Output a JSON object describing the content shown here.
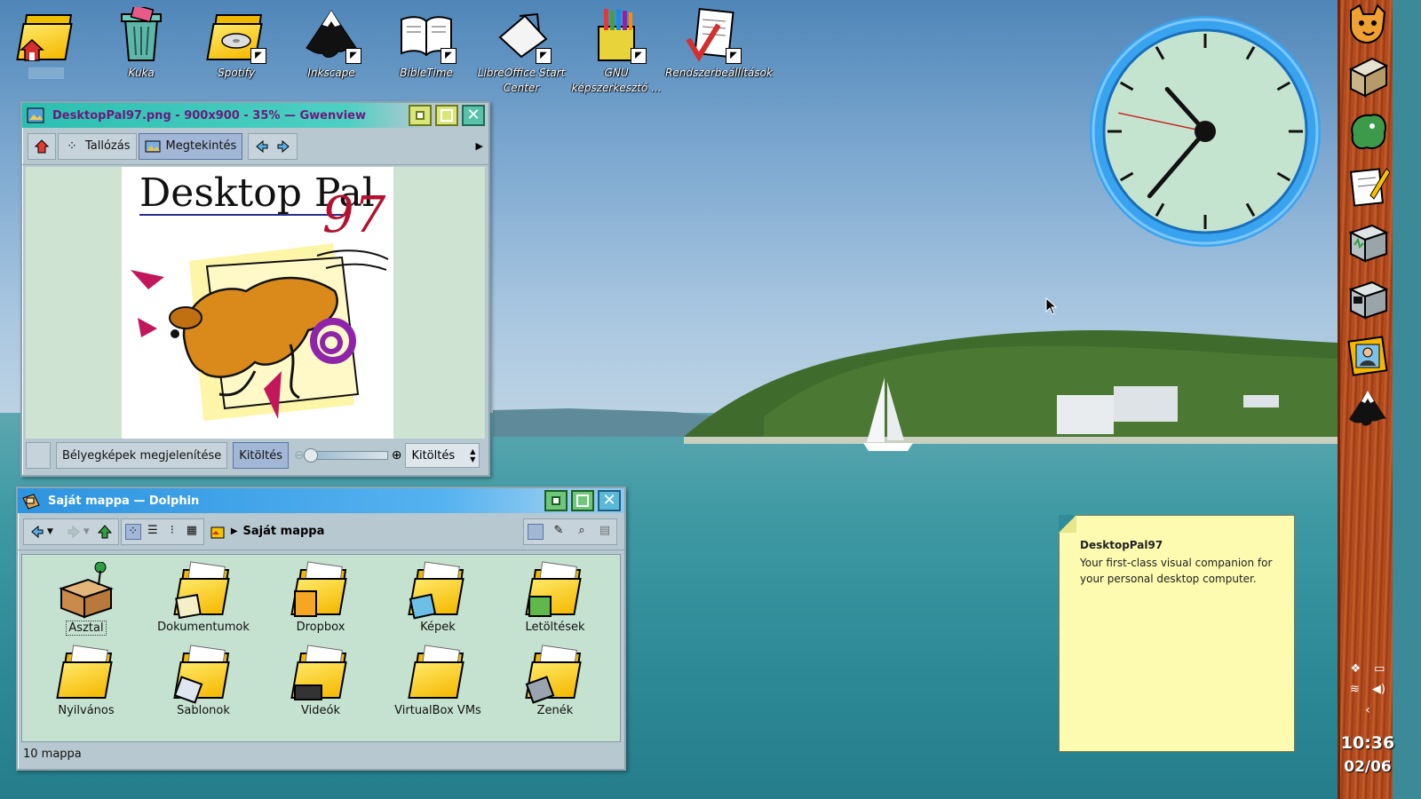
{
  "desktop_icons": [
    {
      "label": "",
      "icon": "home-folder-icon"
    },
    {
      "label": "Kuka",
      "icon": "trash-icon"
    },
    {
      "label": "Spotify",
      "icon": "spotify-icon"
    },
    {
      "label": "Inkscape",
      "icon": "inkscape-icon"
    },
    {
      "label": "BibleTime",
      "icon": "bibletime-icon"
    },
    {
      "label": "LibreOffice Start Center",
      "icon": "libreoffice-icon"
    },
    {
      "label": "GNU képszerkesztő ...",
      "icon": "gimp-icon"
    },
    {
      "label": "Rendszerbeállítások",
      "icon": "system-settings-icon"
    }
  ],
  "gwenview": {
    "title": "DesktopPal97.png - 900x900 - 35% — Gwenview",
    "toolbar": {
      "browse": "Tallózás",
      "view": "Megtekintés"
    },
    "image": {
      "title": "Desktop Pal",
      "suffix": "97"
    },
    "statusbar": {
      "thumbnails": "Bélyegképek megjelenítése",
      "fill": "Kitöltés",
      "zoom_select": "Kitöltés"
    }
  },
  "dolphin": {
    "title": "Saját mappa — Dolphin",
    "breadcrumb": "Saját mappa",
    "items": [
      {
        "label": "Asztal",
        "selected": true
      },
      {
        "label": "Dokumentumok"
      },
      {
        "label": "Dropbox"
      },
      {
        "label": "Képek"
      },
      {
        "label": "Letöltések"
      },
      {
        "label": "Nyilvános"
      },
      {
        "label": "Sablonok"
      },
      {
        "label": "Videók"
      },
      {
        "label": "VirtualBox VMs"
      },
      {
        "label": "Zenék"
      }
    ],
    "status": "10 mappa"
  },
  "note": {
    "title": "DesktopPal97",
    "text": "Your first-class visual companion for your personal desktop computer."
  },
  "panel": {
    "time": "10:36",
    "date": "02/06",
    "launchers": [
      "fox-icon",
      "file-cabinet-icon",
      "dragon-icon",
      "notepad-icon",
      "system-monitor-icon",
      "terminal-icon",
      "user-photo-icon",
      "inkscape-icon"
    ]
  },
  "clock": {
    "hours": 10,
    "minutes": 36,
    "seconds": 47
  }
}
